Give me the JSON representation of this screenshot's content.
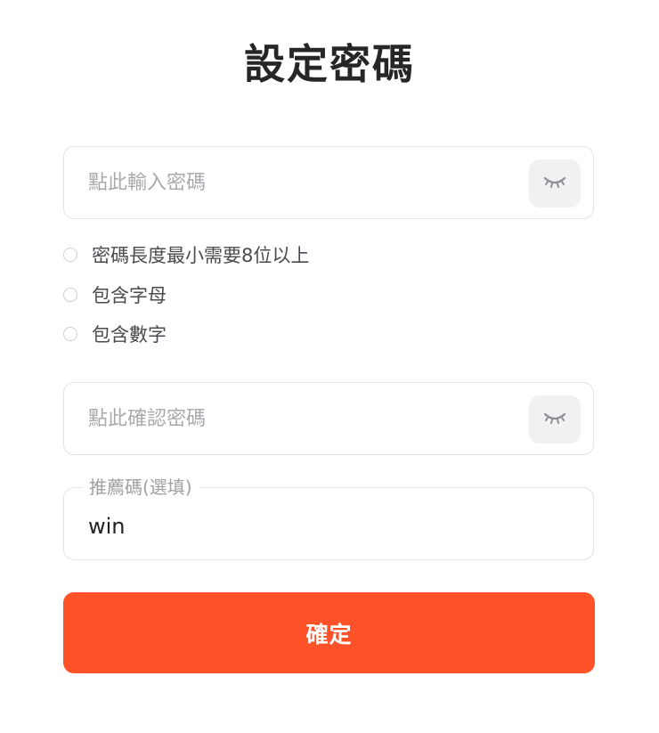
{
  "header": {
    "title": "設定密碼"
  },
  "password": {
    "placeholder": "點此輸入密碼",
    "value": "",
    "toggle_icon": "eye-closed-icon"
  },
  "rules": [
    {
      "text": "密碼長度最小需要8位以上",
      "met": false
    },
    {
      "text": "包含字母",
      "met": false
    },
    {
      "text": "包含數字",
      "met": false
    }
  ],
  "confirm_password": {
    "placeholder": "點此確認密碼",
    "value": "",
    "toggle_icon": "eye-closed-icon"
  },
  "referral": {
    "label": "推薦碼(選填)",
    "value": "win"
  },
  "submit": {
    "label": "確定",
    "color": "#ff5229"
  }
}
